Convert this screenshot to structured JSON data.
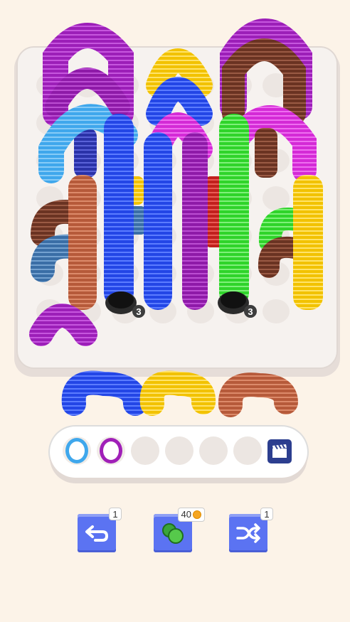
{
  "board": {
    "counter_left": "3",
    "counter_right": "3"
  },
  "queue": {
    "springs": [
      {
        "name": "blue-spring",
        "color": "#2346e6"
      },
      {
        "name": "yellow-spring",
        "color": "#f2c200"
      },
      {
        "name": "rust-spring",
        "color": "#b65a3a"
      }
    ]
  },
  "tray": {
    "filled": [
      {
        "name": "light-blue-ring",
        "color": "#3fa7ec"
      },
      {
        "name": "purple-ring",
        "color": "#a020b8"
      }
    ],
    "empty_slots": 4,
    "video_icon": "clapperboard-icon"
  },
  "toolbar": {
    "undo_count": "1",
    "hint_cost": "40",
    "shuffle_count": "1"
  },
  "colors": {
    "background": "#fcf3e8",
    "board": "#f6f2ef",
    "button": "#5b73f2",
    "purple": "#9c1fb8",
    "magenta": "#d42ad6",
    "blue": "#2346e6",
    "light_blue": "#3fa7ec",
    "green": "#2fd42a",
    "yellow": "#f2c200",
    "brown": "#6a3322",
    "rust": "#b65a3a",
    "red": "#c1201d",
    "steel_blue": "#3a6ea6"
  }
}
